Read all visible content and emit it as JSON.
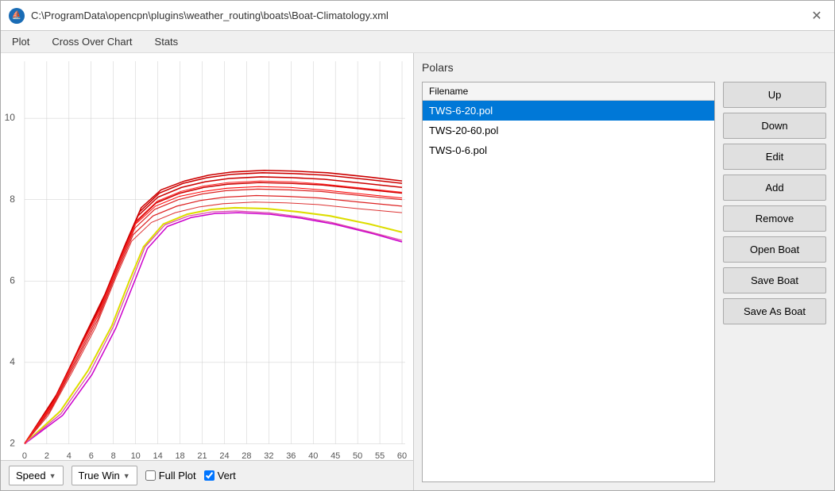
{
  "window": {
    "title": "C:\\ProgramData\\opencpn\\plugins\\weather_routing\\boats\\Boat-Climatology.xml",
    "icon_label": "⛵"
  },
  "menu": {
    "items": [
      "Plot",
      "Cross Over Chart",
      "Stats"
    ]
  },
  "chart": {
    "x_labels": [
      "0",
      "2",
      "4",
      "6",
      "8",
      "10",
      "14",
      "18",
      "21",
      "24",
      "28",
      "32",
      "36",
      "40",
      "45",
      "50",
      "55",
      "60"
    ],
    "y_labels": [
      "2",
      "4",
      "6",
      "8",
      "10"
    ],
    "controls": {
      "speed_label": "Speed",
      "speed_dropdown": "Speed",
      "wind_label": "True Win",
      "wind_dropdown": "True Win",
      "full_plot_label": "Full Plot",
      "vert_label": "Vert"
    }
  },
  "polars": {
    "section_title": "Polars",
    "list_header": "Filename",
    "items": [
      {
        "name": "TWS-6-20.pol",
        "selected": true
      },
      {
        "name": "TWS-20-60.pol",
        "selected": false
      },
      {
        "name": "TWS-0-6.pol",
        "selected": false
      }
    ],
    "buttons": [
      "Up",
      "Down",
      "Edit",
      "Add",
      "Remove",
      "Open Boat",
      "Save Boat",
      "Save As Boat"
    ]
  }
}
